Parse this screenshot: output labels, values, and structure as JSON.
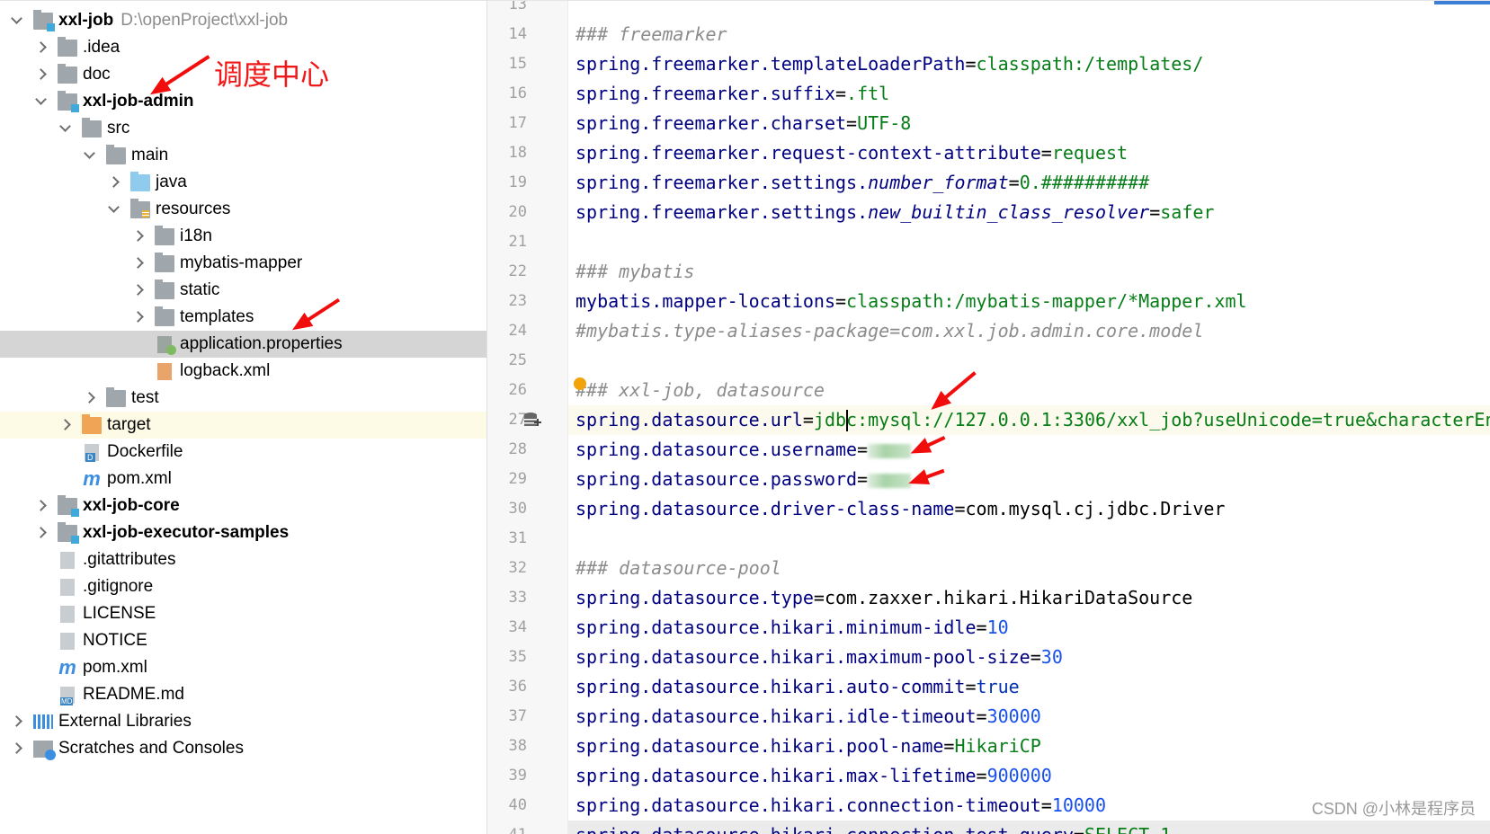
{
  "project_tree": {
    "items": [
      {
        "label": "xxl-job",
        "path": "D:\\openProject\\xxl-job",
        "level": 0,
        "chevron": "open",
        "icon": "module-folder-icon",
        "bold": true
      },
      {
        "label": ".idea",
        "level": 1,
        "chevron": "closed",
        "icon": "folder-icon"
      },
      {
        "label": "doc",
        "level": 1,
        "chevron": "closed",
        "icon": "folder-icon"
      },
      {
        "label": "xxl-job-admin",
        "level": 1,
        "chevron": "open",
        "icon": "module-folder-icon",
        "bold": true
      },
      {
        "label": "src",
        "level": 2,
        "chevron": "open",
        "icon": "folder-icon"
      },
      {
        "label": "main",
        "level": 3,
        "chevron": "open",
        "icon": "folder-icon"
      },
      {
        "label": "java",
        "level": 4,
        "chevron": "closed",
        "icon": "source-folder-icon"
      },
      {
        "label": "resources",
        "level": 4,
        "chevron": "open",
        "icon": "resources-folder-icon"
      },
      {
        "label": "i18n",
        "level": 5,
        "chevron": "closed",
        "icon": "folder-icon"
      },
      {
        "label": "mybatis-mapper",
        "level": 5,
        "chevron": "closed",
        "icon": "folder-icon"
      },
      {
        "label": "static",
        "level": 5,
        "chevron": "closed",
        "icon": "folder-icon"
      },
      {
        "label": "templates",
        "level": 5,
        "chevron": "closed",
        "icon": "folder-icon"
      },
      {
        "label": "application.properties",
        "level": 5,
        "chevron": "none",
        "icon": "properties-file-icon",
        "selected": true
      },
      {
        "label": "logback.xml",
        "level": 5,
        "chevron": "none",
        "icon": "xml-file-icon"
      },
      {
        "label": "test",
        "level": 3,
        "chevron": "closed",
        "icon": "folder-icon"
      },
      {
        "label": "target",
        "level": 2,
        "chevron": "closed",
        "icon": "excluded-folder-icon",
        "highlighted": true
      },
      {
        "label": "Dockerfile",
        "level": 2,
        "chevron": "none",
        "icon": "docker-file-icon"
      },
      {
        "label": "pom.xml",
        "level": 2,
        "chevron": "none",
        "icon": "maven-icon"
      },
      {
        "label": "xxl-job-core",
        "level": 1,
        "chevron": "closed",
        "icon": "module-folder-icon",
        "bold": true
      },
      {
        "label": "xxl-job-executor-samples",
        "level": 1,
        "chevron": "closed",
        "icon": "module-folder-icon",
        "bold": true
      },
      {
        "label": ".gitattributes",
        "level": 1,
        "chevron": "none",
        "icon": "text-file-icon"
      },
      {
        "label": ".gitignore",
        "level": 1,
        "chevron": "none",
        "icon": "ignore-file-icon"
      },
      {
        "label": "LICENSE",
        "level": 1,
        "chevron": "none",
        "icon": "text-file-icon"
      },
      {
        "label": "NOTICE",
        "level": 1,
        "chevron": "none",
        "icon": "text-file-icon"
      },
      {
        "label": "pom.xml",
        "level": 1,
        "chevron": "none",
        "icon": "maven-icon"
      },
      {
        "label": "README.md",
        "level": 1,
        "chevron": "none",
        "icon": "markdown-file-icon"
      },
      {
        "label": "External Libraries",
        "level": 0,
        "chevron": "closed",
        "icon": "libraries-icon"
      },
      {
        "label": "Scratches and Consoles",
        "level": 0,
        "chevron": "closed",
        "icon": "scratches-icon"
      }
    ]
  },
  "annotation": {
    "text": "调度中心",
    "color": "#f01818"
  },
  "watermark": "CSDN @小林是程序员",
  "editor": {
    "current_line": 27,
    "lines": [
      {
        "n": 13,
        "s": []
      },
      {
        "n": 14,
        "s": [
          [
            "### freemarker",
            "c"
          ]
        ]
      },
      {
        "n": 15,
        "s": [
          [
            "spring.freemarker.templateLoaderPath",
            "k"
          ],
          [
            "=",
            "p"
          ],
          [
            "classpath:/templates/",
            "v"
          ]
        ]
      },
      {
        "n": 16,
        "s": [
          [
            "spring.freemarker.suffix",
            "k"
          ],
          [
            "=",
            "p"
          ],
          [
            ".ftl",
            "v"
          ]
        ]
      },
      {
        "n": 17,
        "s": [
          [
            "spring.freemarker.charset",
            "k"
          ],
          [
            "=",
            "p"
          ],
          [
            "UTF-8",
            "v"
          ]
        ]
      },
      {
        "n": 18,
        "s": [
          [
            "spring.freemarker.request-context-attribute",
            "k"
          ],
          [
            "=",
            "p"
          ],
          [
            "request",
            "v"
          ]
        ]
      },
      {
        "n": 19,
        "s": [
          [
            "spring.freemarker.settings.",
            "k"
          ],
          [
            "number_format",
            "ki"
          ],
          [
            "=",
            "p"
          ],
          [
            "0.##########",
            "v"
          ]
        ]
      },
      {
        "n": 20,
        "s": [
          [
            "spring.freemarker.settings.",
            "k"
          ],
          [
            "new_builtin_class_resolver",
            "ki"
          ],
          [
            "=",
            "p"
          ],
          [
            "safer",
            "v"
          ]
        ]
      },
      {
        "n": 21,
        "s": []
      },
      {
        "n": 22,
        "s": [
          [
            "### mybatis",
            "c"
          ]
        ]
      },
      {
        "n": 23,
        "s": [
          [
            "mybatis.mapper-locations",
            "k"
          ],
          [
            "=",
            "p"
          ],
          [
            "classpath:/mybatis-mapper/*Mapper.xml",
            "v"
          ]
        ]
      },
      {
        "n": 24,
        "s": [
          [
            "#mybatis.type-aliases-package=com.xxl.job.admin.core.model",
            "c"
          ]
        ]
      },
      {
        "n": 25,
        "s": []
      },
      {
        "n": 26,
        "s": [
          [
            "### xxl-job, datasource",
            "c"
          ]
        ]
      },
      {
        "n": 27,
        "s": [
          [
            "spring.datasource.url",
            "k"
          ],
          [
            "=",
            "p"
          ],
          [
            "jdbc:mysql://127.0.0.1:3306/xxl_job?useUnicode=true&characterEn",
            "v"
          ]
        ]
      },
      {
        "n": 28,
        "s": [
          [
            "spring.datasource.username",
            "k"
          ],
          [
            "=",
            "p"
          ],
          [
            "",
            "blur"
          ]
        ]
      },
      {
        "n": 29,
        "s": [
          [
            "spring.datasource.password",
            "k"
          ],
          [
            "=",
            "p"
          ],
          [
            "",
            "blur"
          ]
        ]
      },
      {
        "n": 30,
        "s": [
          [
            "spring.datasource.driver-class-name",
            "k"
          ],
          [
            "=",
            "p"
          ],
          [
            "com.mysql.cj.jdbc.Driver",
            "x"
          ]
        ]
      },
      {
        "n": 31,
        "s": []
      },
      {
        "n": 32,
        "s": [
          [
            "### datasource-pool",
            "c"
          ]
        ]
      },
      {
        "n": 33,
        "s": [
          [
            "spring.datasource.type",
            "k"
          ],
          [
            "=",
            "p"
          ],
          [
            "com.zaxxer.hikari.HikariDataSource",
            "x"
          ]
        ]
      },
      {
        "n": 34,
        "s": [
          [
            "spring.datasource.hikari.minimum-idle",
            "k"
          ],
          [
            "=",
            "p"
          ],
          [
            "10",
            "n"
          ]
        ]
      },
      {
        "n": 35,
        "s": [
          [
            "spring.datasource.hikari.maximum-pool-size",
            "k"
          ],
          [
            "=",
            "p"
          ],
          [
            "30",
            "n"
          ]
        ]
      },
      {
        "n": 36,
        "s": [
          [
            "spring.datasource.hikari.auto-commit",
            "k"
          ],
          [
            "=",
            "p"
          ],
          [
            "true",
            "t"
          ]
        ]
      },
      {
        "n": 37,
        "s": [
          [
            "spring.datasource.hikari.idle-timeout",
            "k"
          ],
          [
            "=",
            "p"
          ],
          [
            "30000",
            "n"
          ]
        ]
      },
      {
        "n": 38,
        "s": [
          [
            "spring.datasource.hikari.pool-name",
            "k"
          ],
          [
            "=",
            "p"
          ],
          [
            "HikariCP",
            "v"
          ]
        ]
      },
      {
        "n": 39,
        "s": [
          [
            "spring.datasource.hikari.max-lifetime",
            "k"
          ],
          [
            "=",
            "p"
          ],
          [
            "900000",
            "n"
          ]
        ]
      },
      {
        "n": 40,
        "s": [
          [
            "spring.datasource.hikari.connection-timeout",
            "k"
          ],
          [
            "=",
            "p"
          ],
          [
            "10000",
            "n"
          ]
        ]
      },
      {
        "n": 41,
        "s": [
          [
            "spring.datasource.hikari.connection-test-query",
            "k"
          ],
          [
            "=",
            "p"
          ],
          [
            "SELECT 1",
            "v"
          ]
        ]
      }
    ]
  }
}
